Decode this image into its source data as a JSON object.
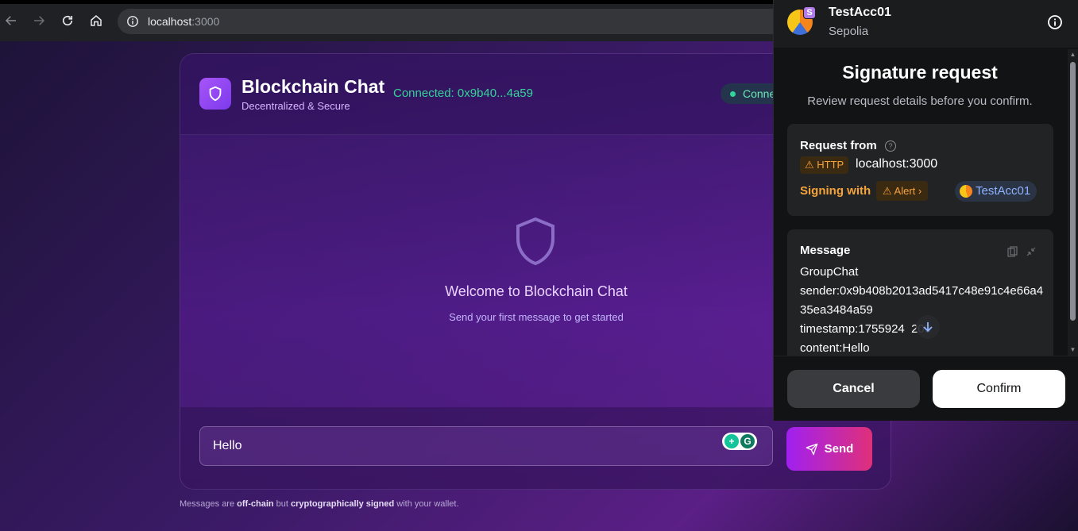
{
  "browser": {
    "url_host": "localhost",
    "url_port": ":3000"
  },
  "chat": {
    "title": "Blockchain Chat",
    "subtitle": "Decentralized & Secure",
    "connected_address": "Connected: 0x9b40...4a59",
    "status_pill": "Conne",
    "welcome_title": "Welcome to Blockchain Chat",
    "welcome_subtitle": "Send your first message to get started",
    "input_value": "Hello",
    "send_label": "Send",
    "footnote": {
      "part1": "Messages are ",
      "bold1": "off-chain",
      "part2": " but ",
      "bold2": "cryptographically signed",
      "part3": " with your wallet."
    }
  },
  "wallet": {
    "account_name": "TestAcc01",
    "network": "Sepolia",
    "network_badge": "S",
    "title": "Signature request",
    "subtitle": "Review request details before you confirm.",
    "request_from_label": "Request from",
    "http_tag": "⚠ HTTP",
    "origin": "localhost:3000",
    "signing_with_label": "Signing with",
    "alert_tag": "⚠ Alert ›",
    "signing_account": "TestAcc01",
    "message_label": "Message",
    "message_lines": [
      "GroupChat",
      "sender:0x9b408b2013ad5417c48e91c4e66a435ea3484a59",
      "timestamp:1755924  209",
      "content:Hello"
    ],
    "cancel_label": "Cancel",
    "confirm_label": "Confirm"
  },
  "colors": {
    "accent_purple": "#a855f7",
    "connected_green": "#34d399",
    "warning_orange": "#f6a33a",
    "wallet_bg": "#121314"
  }
}
